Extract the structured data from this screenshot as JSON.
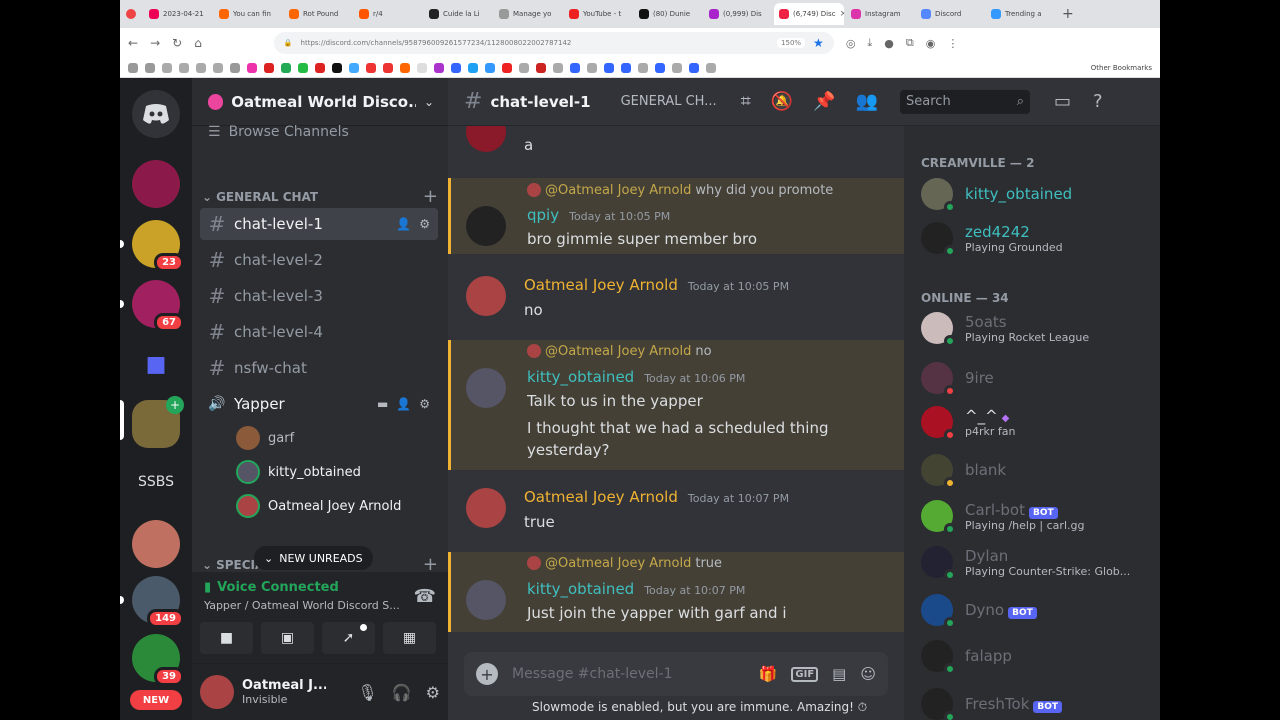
{
  "colors": {
    "accent": "#5865f2",
    "online": "#23a55a",
    "idle": "#f0b232",
    "dnd": "#f23f43",
    "mention": "#f0b232"
  },
  "browser": {
    "tabs": [
      "2023-04-21",
      "You can fin",
      "Rot Pound",
      "r/4",
      "Cuide la Li",
      "Manage yo",
      "YouTube - t",
      "(80) Dunie",
      "(0,999) Dis",
      "(6,749) Disc",
      "Instagram",
      "Discord",
      "Trending a"
    ],
    "active_tab": 9,
    "url": "https://discord.com/channels/958796009261577234/1128008022002787142",
    "zoom": "150%",
    "other_bookmarks": "Other Bookmarks"
  },
  "guilds": {
    "badges": [
      "23",
      "67",
      "149",
      "39"
    ],
    "ssbs": "SSBS",
    "new": "NEW"
  },
  "server": {
    "name": "Oatmeal World Disco...",
    "browse": "Browse Channels",
    "category1": "GENERAL CHAT",
    "channels": [
      "chat-level-1",
      "chat-level-2",
      "chat-level-3",
      "chat-level-4",
      "nsfw-chat"
    ],
    "voice_channel": "Yapper",
    "voice_users": [
      "garf",
      "kitty_obtained",
      "Oatmeal Joey Arnold"
    ],
    "category2": "SPECIAL",
    "new_unreads": "NEW UNREADS"
  },
  "voice": {
    "status": "Voice Connected",
    "sub": "Yapper / Oatmeal World Discord S..."
  },
  "user": {
    "name": "Oatmeal J...",
    "status": "Invisible"
  },
  "channel": {
    "name": "chat-level-1",
    "topic": "GENERAL CH...",
    "search_placeholder": "Search"
  },
  "messages": {
    "m0": {
      "text": "a"
    },
    "m1": {
      "reply_to": "@Oatmeal Joey Arnold",
      "reply_text": "why did you promote",
      "author": "qpiy",
      "ts": "Today at 10:05 PM",
      "text": "bro gimmie super member bro"
    },
    "m2": {
      "author": "Oatmeal Joey Arnold",
      "ts": "Today at 10:05 PM",
      "text": "no"
    },
    "m3": {
      "reply_to": "@Oatmeal Joey Arnold",
      "reply_text": "no",
      "author": "kitty_obtained",
      "ts": "Today at 10:06 PM",
      "text": "Talk to us in the yapper",
      "text2": "I thought that we had a scheduled thing yesterday?"
    },
    "m4": {
      "author": "Oatmeal Joey Arnold",
      "ts": "Today at 10:07 PM",
      "text": "true"
    },
    "m5": {
      "reply_to": "@Oatmeal Joey Arnold",
      "reply_text": "true",
      "author": "kitty_obtained",
      "ts": "Today at 10:07 PM",
      "text": "Just join the yapper with garf and i"
    }
  },
  "composer": {
    "placeholder": "Message #chat-level-1",
    "gif": "GIF",
    "slowmode": "Slowmode is enabled, but you are immune. Amazing!"
  },
  "members": {
    "cat1": "CREAMVILLE — 2",
    "cat2": "ONLINE — 34",
    "bot_tag": "BOT",
    "list": [
      {
        "name": "kitty_obtained",
        "activity": ""
      },
      {
        "name": "zed4242",
        "activity": "Playing Grounded"
      },
      {
        "name": "5oats",
        "activity": "Playing Rocket League"
      },
      {
        "name": "9ire",
        "activity": ""
      },
      {
        "name": "^_^",
        "activity": "p4rkr fan"
      },
      {
        "name": "blank",
        "activity": ""
      },
      {
        "name": "Carl-bot",
        "activity": "Playing /help | carl.gg"
      },
      {
        "name": "Dylan",
        "activity": "Playing Counter-Strike: Glob..."
      },
      {
        "name": "Dyno",
        "activity": ""
      },
      {
        "name": "falapp",
        "activity": ""
      },
      {
        "name": "FreshTok",
        "activity": ""
      }
    ]
  }
}
